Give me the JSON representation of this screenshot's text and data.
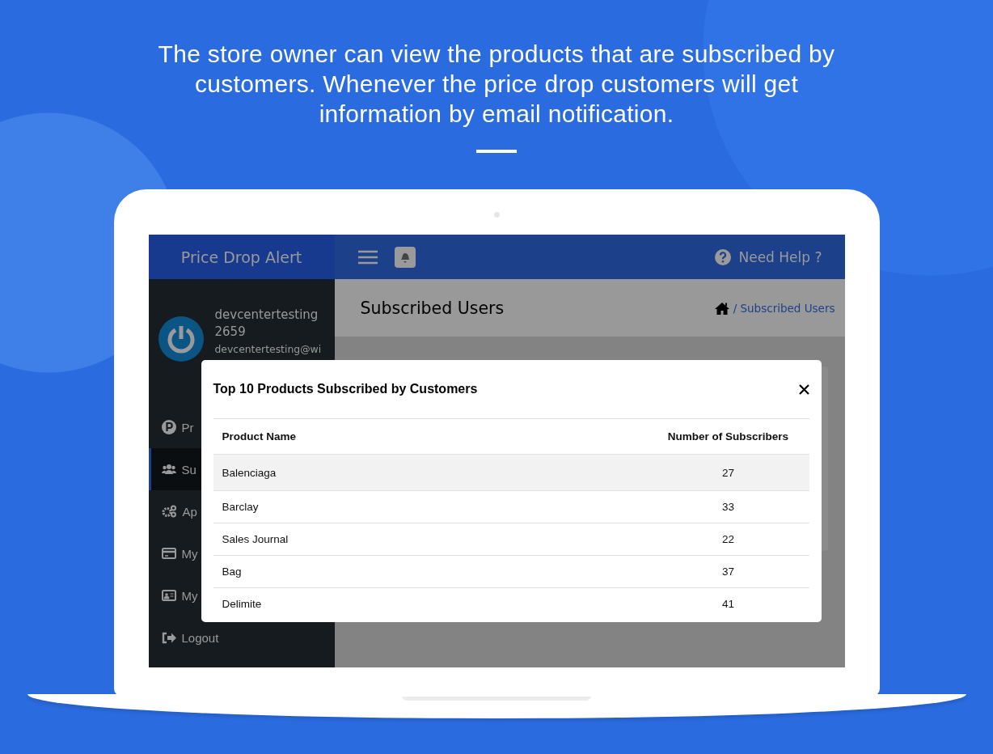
{
  "headline": "The store owner can view the products that are subscribed by customers. Whenever the price drop customers will get information by email notification.",
  "app": {
    "brand": "Price Drop Alert",
    "help": "Need Help ?",
    "user": {
      "name": "devcentertesting 2659",
      "email": "devcentertesting@wi"
    },
    "sidebar": {
      "items": [
        {
          "label": "Pr",
          "kind": "product",
          "selected": false
        },
        {
          "label": "Su",
          "kind": "users",
          "selected": true
        },
        {
          "label": "Ap",
          "kind": "settings",
          "selected": false
        },
        {
          "label": "My",
          "kind": "card",
          "selected": false
        },
        {
          "label": "My",
          "kind": "profile",
          "selected": false
        },
        {
          "label": "Logout",
          "kind": "logout",
          "selected": false
        }
      ]
    },
    "page_title": "Subscribed Users",
    "breadcrumb": "/ Subscribed Users",
    "modal": {
      "title": "Top 10 Products Subscribed by Customers",
      "columns": [
        "Product Name",
        "Number of Subscribers"
      ],
      "rows": [
        {
          "product": "Balenciaga",
          "subscribers": "27",
          "highlighted": true
        },
        {
          "product": "Barclay",
          "subscribers": "33",
          "highlighted": false
        },
        {
          "product": "Sales Journal",
          "subscribers": "22",
          "highlighted": false
        },
        {
          "product": "Bag",
          "subscribers": "37",
          "highlighted": false
        },
        {
          "product": "Delimite",
          "subscribers": "41",
          "highlighted": false
        }
      ]
    }
  }
}
